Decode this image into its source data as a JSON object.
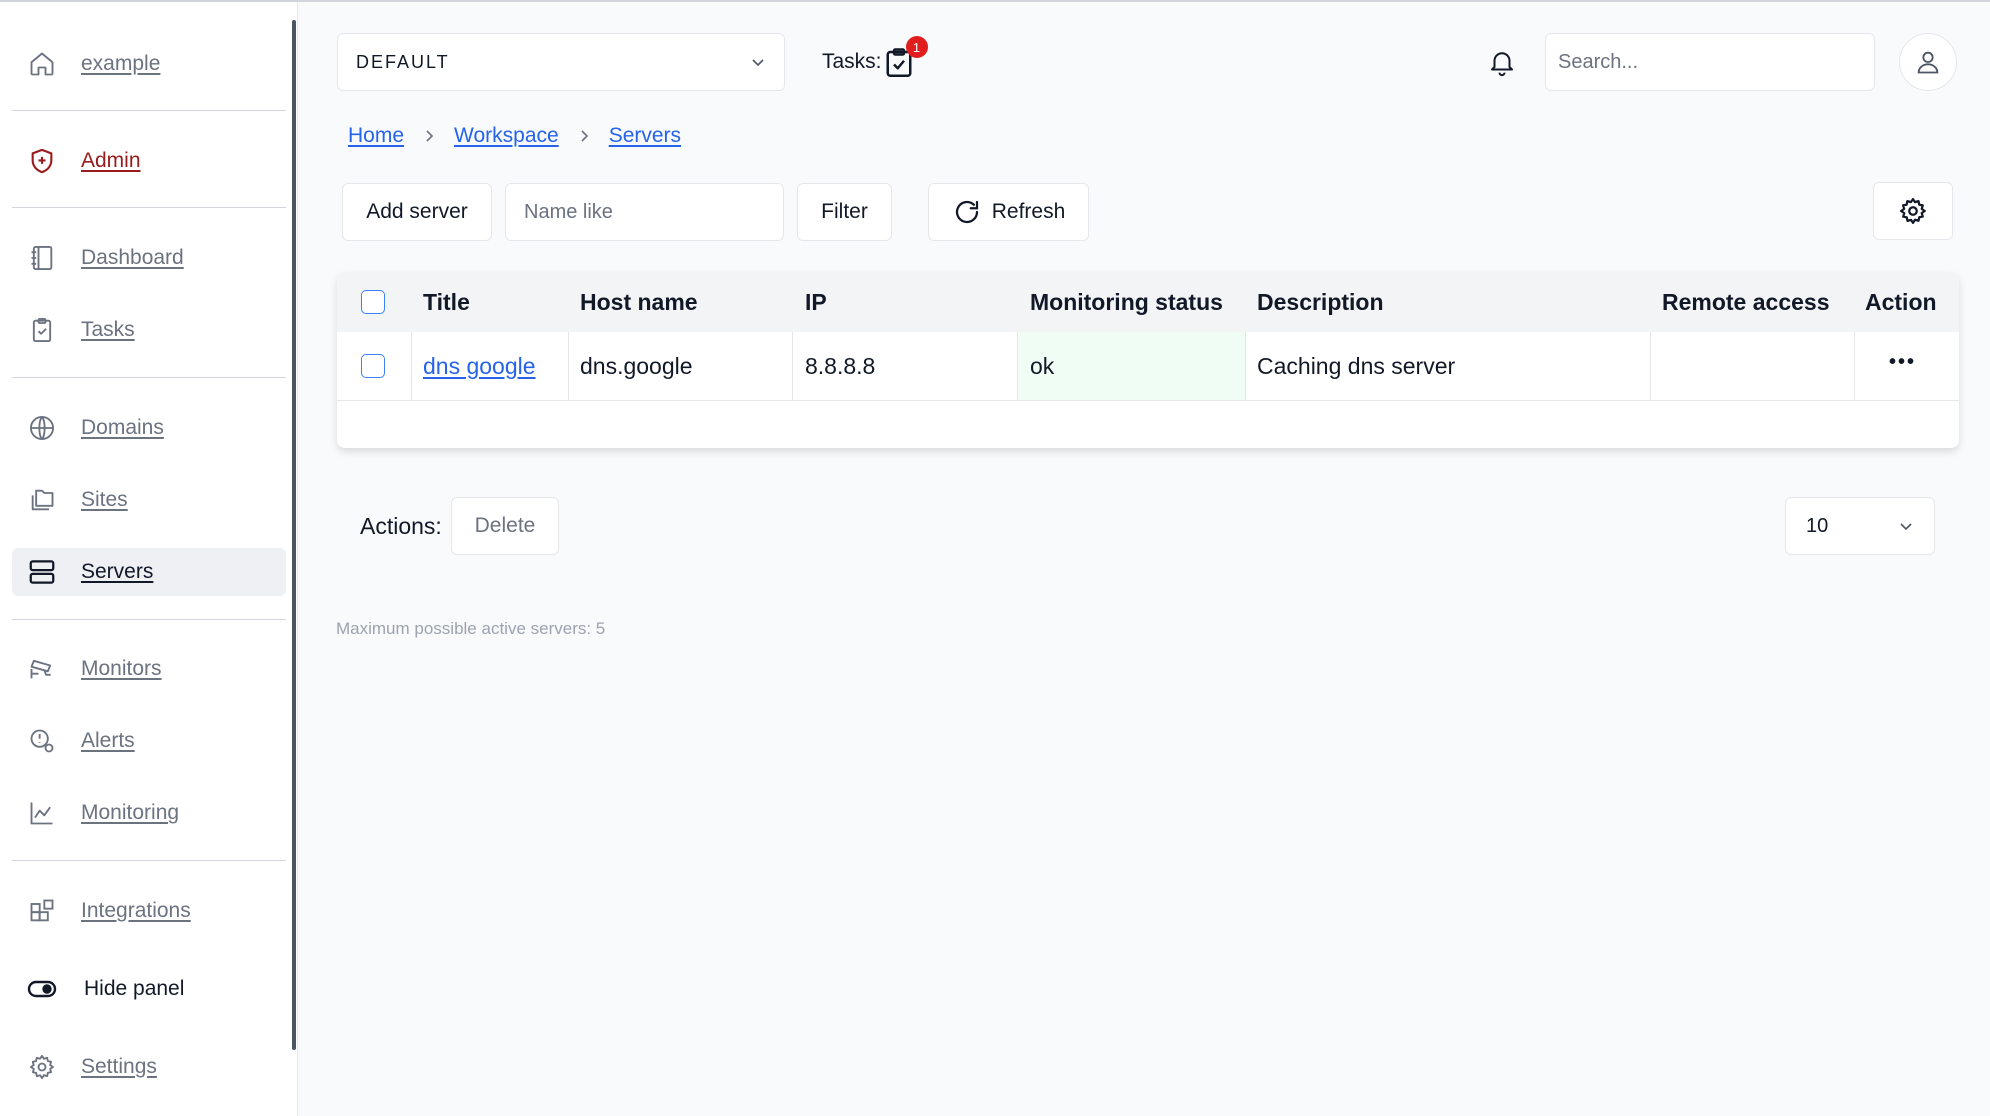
{
  "sidebar": {
    "items": [
      {
        "label": "example",
        "icon": "home-icon"
      },
      {
        "label": "Admin",
        "icon": "shield-plus-icon"
      },
      {
        "label": "Dashboard",
        "icon": "notebook-icon"
      },
      {
        "label": "Tasks",
        "icon": "clipboard-check-icon"
      },
      {
        "label": "Domains",
        "icon": "globe-icon"
      },
      {
        "label": "Sites",
        "icon": "folders-icon"
      },
      {
        "label": "Servers",
        "icon": "server-icon"
      },
      {
        "label": "Monitors",
        "icon": "cctv-icon"
      },
      {
        "label": "Alerts",
        "icon": "alert-bell-icon"
      },
      {
        "label": "Monitoring",
        "icon": "line-chart-icon"
      },
      {
        "label": "Integrations",
        "icon": "blocks-icon"
      },
      {
        "label": "Hide panel",
        "icon": "toggle-icon"
      },
      {
        "label": "Settings",
        "icon": "gear-icon"
      }
    ],
    "active_item": "Servers"
  },
  "header": {
    "workspace": "DEFAULT",
    "tasks_label": "Tasks:",
    "tasks_count": "1",
    "search_placeholder": "Search..."
  },
  "breadcrumb": [
    "Home",
    "Workspace",
    "Servers"
  ],
  "toolbar": {
    "add_label": "Add server",
    "name_placeholder": "Name like",
    "filter_label": "Filter",
    "refresh_label": "Refresh"
  },
  "table": {
    "columns": [
      "Title",
      "Host name",
      "IP",
      "Monitoring status",
      "Description",
      "Remote access",
      "Action"
    ],
    "rows": [
      {
        "title": "dns google",
        "host": "dns.google",
        "ip": "8.8.8.8",
        "status": "ok",
        "description": "Caching dns server",
        "remote": "",
        "action": "•••"
      }
    ]
  },
  "actions": {
    "label": "Actions:",
    "delete_label": "Delete",
    "page_size": "10"
  },
  "footer_note": "Maximum possible active servers: 5",
  "colors": {
    "link": "#2563eb",
    "admin": "#991b1b",
    "badge": "#e11d1d",
    "status_ok_bg": "#f0fdf4"
  }
}
